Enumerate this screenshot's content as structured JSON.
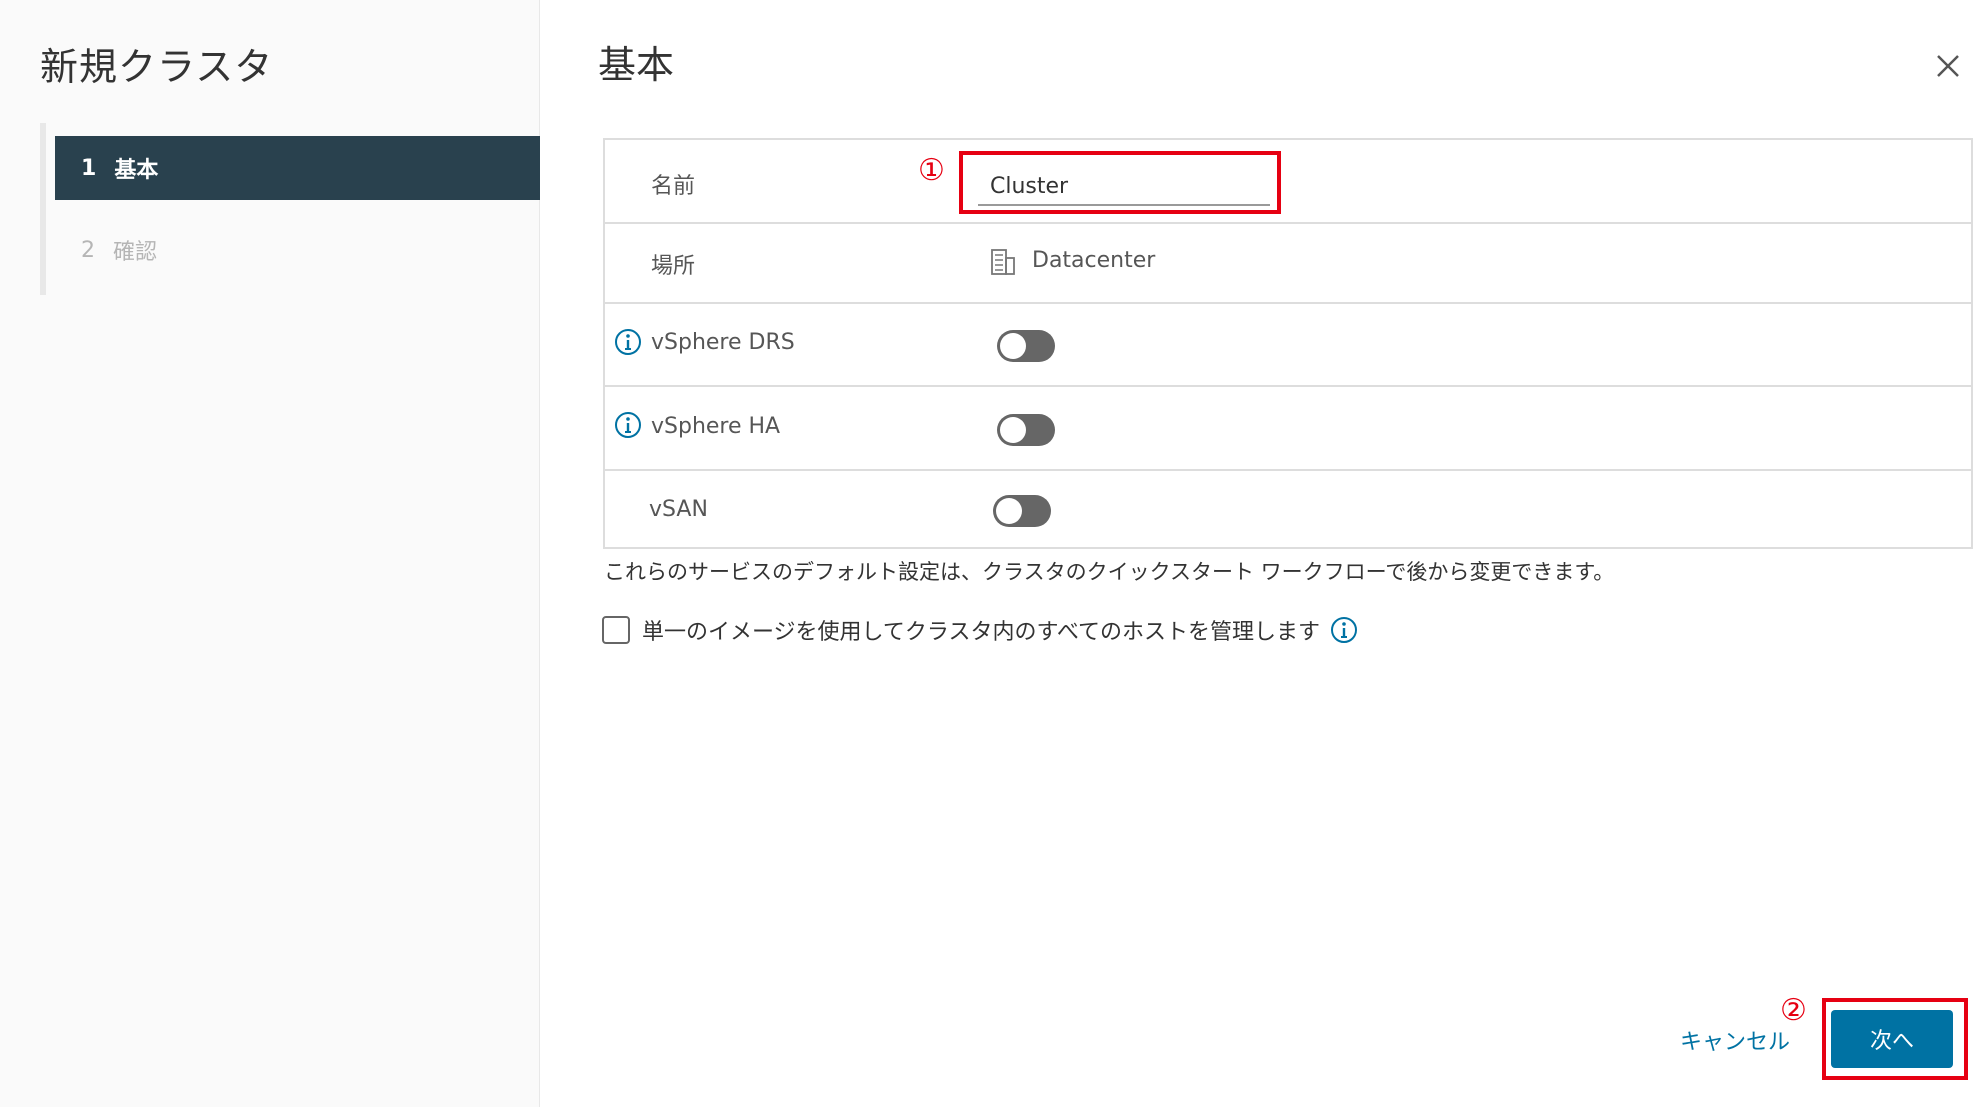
{
  "wizard": {
    "title": "新規クラスタ",
    "steps": [
      {
        "num": "1",
        "label": "基本"
      },
      {
        "num": "2",
        "label": "確認"
      }
    ]
  },
  "main": {
    "title": "基本",
    "close_icon": "close-icon"
  },
  "form": {
    "name_label": "名前",
    "name_value": "Cluster",
    "location_label": "場所",
    "location_value": "Datacenter",
    "location_icon": "datacenter-icon",
    "drs_label": "vSphere DRS",
    "drs_enabled": false,
    "ha_label": "vSphere HA",
    "ha_enabled": false,
    "vsan_label": "vSAN",
    "vsan_enabled": false
  },
  "hint": "これらのサービスのデフォルト設定は、クラスタのクイックスタート ワークフローで後から変更できます。",
  "image_option": {
    "label": "単一のイメージを使用してクラスタ内のすべてのホストを管理します",
    "checked": false
  },
  "annotations": {
    "marker1": "①",
    "marker2": "②",
    "highlight_color": "#e60012"
  },
  "footer": {
    "cancel_label": "キャンセル",
    "next_label": "次へ"
  },
  "colors": {
    "accent": "#0072a3",
    "sidebar_active": "#29414e"
  }
}
